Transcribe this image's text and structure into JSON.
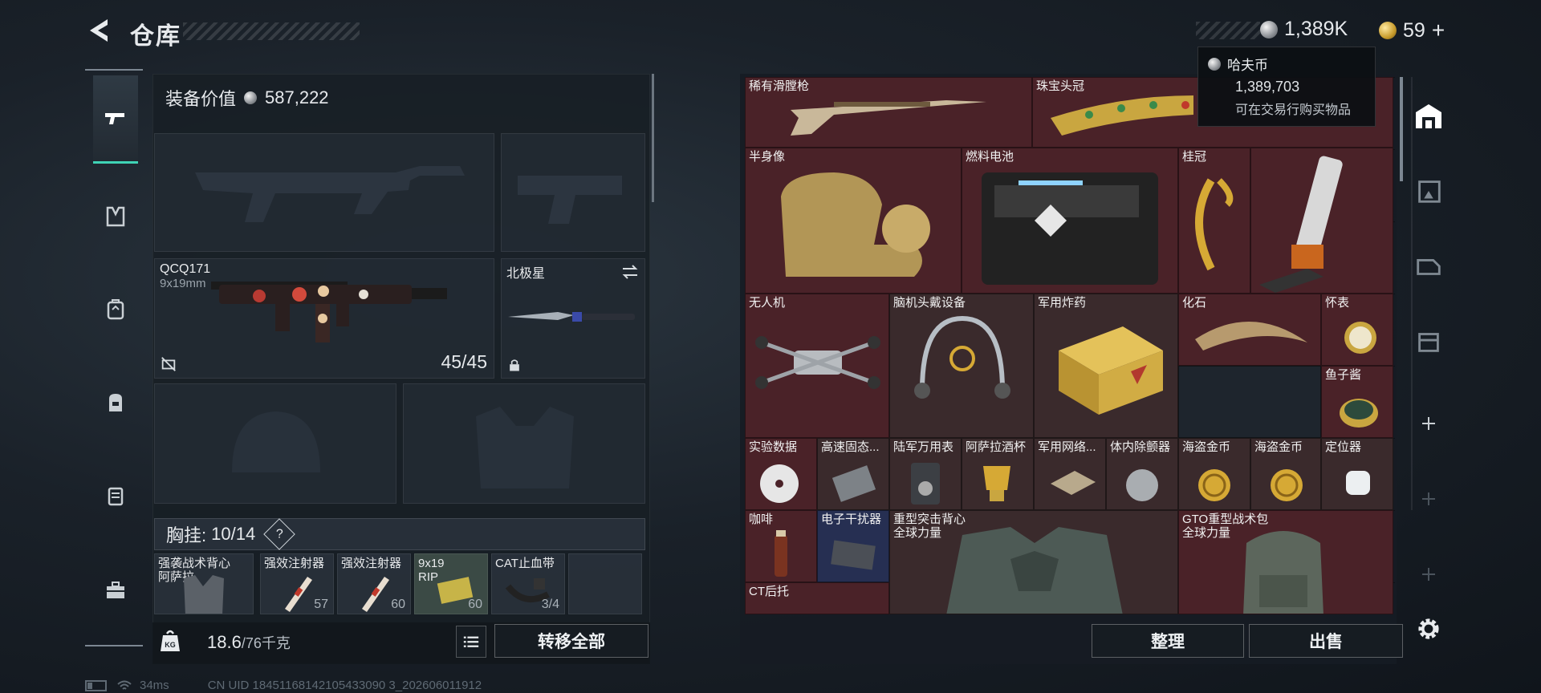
{
  "header": {
    "title": "仓库",
    "silver": "1,389K",
    "gold": "59",
    "gold_add": "+"
  },
  "tooltip": {
    "name": "哈夫币",
    "value": "1,389,703",
    "desc": "可在交易行购买物品"
  },
  "loadout": {
    "equip_value_label": "装备价值",
    "equip_value": "587,222",
    "primary_name": "QCQ171",
    "primary_caliber": "9x19mm",
    "primary_ammo": "45/45",
    "melee_name": "北极星",
    "chest_label": "胸挂:",
    "chest_capacity": "10/14",
    "help": "?",
    "items": [
      {
        "name": "强袭战术背心\n阿萨拉",
        "count": ""
      },
      {
        "name": "强效注射器",
        "count": "57"
      },
      {
        "name": "强效注射器",
        "count": "60"
      },
      {
        "name": "9x19\nRIP",
        "count": "60"
      },
      {
        "name": "CAT止血带",
        "count": "3/4"
      }
    ],
    "weight": "18.6",
    "weight_max": "/76千克",
    "transfer_all": "转移全部"
  },
  "stash": {
    "items": [
      "稀有滑膛枪",
      "珠宝头冠",
      "半身像",
      "燃料电池",
      "桂冠",
      "无人机",
      "脑机头戴设备",
      "军用炸药",
      "化石",
      "怀表",
      "鱼子酱",
      "实验数据",
      "高速固态...",
      "陆军万用表",
      "阿萨拉酒杯",
      "军用网络...",
      "体内除颤器",
      "海盗金币",
      "海盗金币",
      "定位器",
      "咖啡",
      "电子干扰器",
      "重型突击背心\n全球力量",
      "GTO重型战术包\n全球力量",
      "CT后托"
    ],
    "sort": "整理",
    "sell": "出售"
  },
  "status": {
    "ping": "34ms",
    "uid": "CN UID 18451168142105433090 3_202606011912"
  },
  "colors": {
    "accent": "#3fd3b5",
    "red_cell": "#4a2228",
    "blue_cell": "#262f52"
  }
}
